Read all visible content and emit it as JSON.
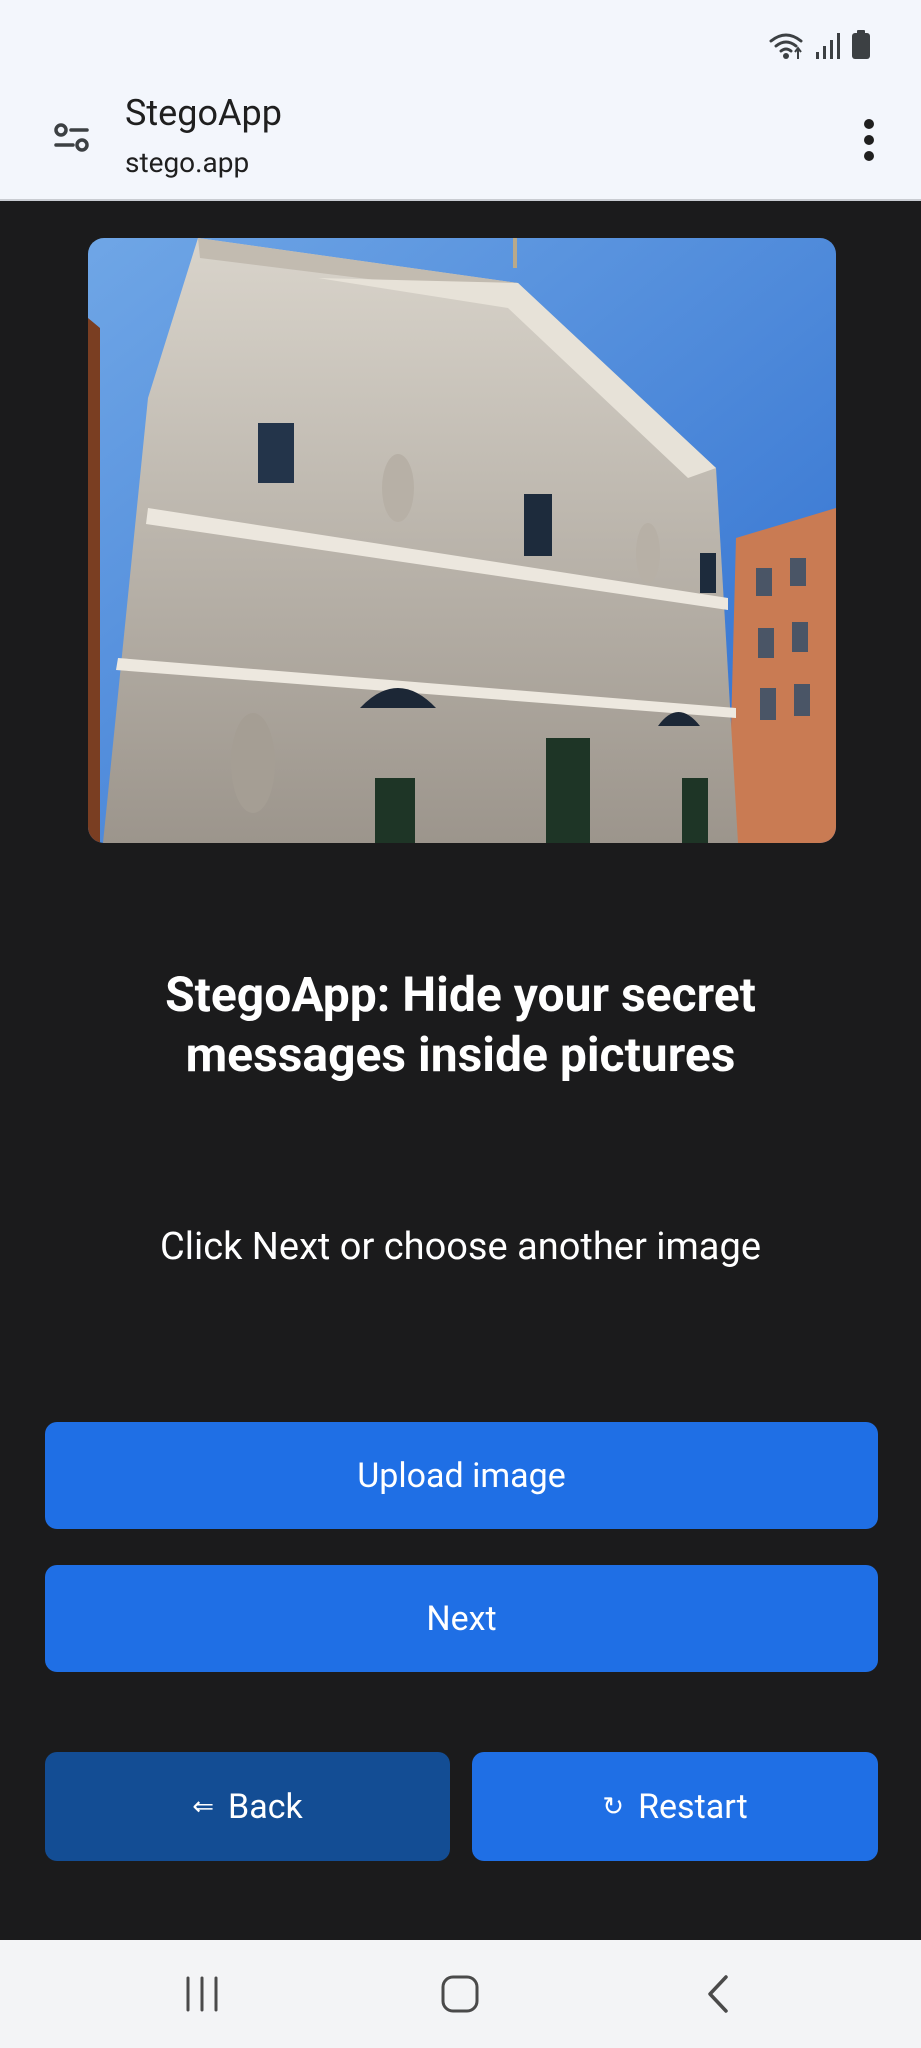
{
  "status_bar": {
    "icons": [
      "wifi-icon",
      "signal-icon",
      "battery-icon"
    ]
  },
  "header": {
    "title": "StegoApp",
    "url": "stego.app",
    "left_icon": "tune-icon",
    "right_icon": "more-vert-icon"
  },
  "main": {
    "headline": "StegoApp: Hide your secret messages inside pictures",
    "instruction": "Click Next or choose another image",
    "upload_label": "Upload image",
    "next_label": "Next",
    "back_glyph": "⇐",
    "back_label": "Back",
    "restart_glyph": "↻",
    "restart_label": "Restart"
  },
  "nav_bar": {
    "icons": [
      "recents-icon",
      "home-icon",
      "back-icon"
    ]
  },
  "colors": {
    "page_background": "#1b1b1c",
    "chrome_background": "#f3f6fc",
    "primary_button": "#1f6fe5",
    "back_button": "#134d94",
    "text_on_dark": "#ffffff"
  }
}
